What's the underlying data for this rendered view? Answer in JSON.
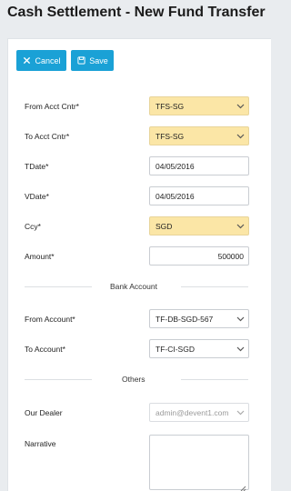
{
  "page": {
    "title": "Cash Settlement - New Fund Transfer"
  },
  "toolbar": {
    "cancel_label": "Cancel",
    "save_label": "Save"
  },
  "form": {
    "from_acct_cntr": {
      "label": "From Acct Cntr*",
      "value": "TFS-SG"
    },
    "to_acct_cntr": {
      "label": "To Acct Cntr*",
      "value": "TFS-SG"
    },
    "tdate": {
      "label": "TDate*",
      "value": "04/05/2016"
    },
    "vdate": {
      "label": "VDate*",
      "value": "04/05/2016"
    },
    "ccy": {
      "label": "Ccy*",
      "value": "SGD"
    },
    "amount": {
      "label": "Amount*",
      "value": "500000"
    },
    "bank_account_section": "Bank Account",
    "from_account": {
      "label": "From Account*",
      "value": "TF-DB-SGD-567"
    },
    "to_account": {
      "label": "To Account*",
      "value": "TF-CI-SGD"
    },
    "others_section": "Others",
    "our_dealer": {
      "label": "Our Dealer",
      "value": "admin@devent1.com"
    },
    "narrative": {
      "label": "Narrative",
      "value": ""
    }
  },
  "colors": {
    "accent": "#1aa1d6",
    "required_field": "#fbe6a6"
  },
  "icons": {
    "cancel": "close-icon",
    "save": "save-icon",
    "dropdown": "chevron-down-icon"
  }
}
